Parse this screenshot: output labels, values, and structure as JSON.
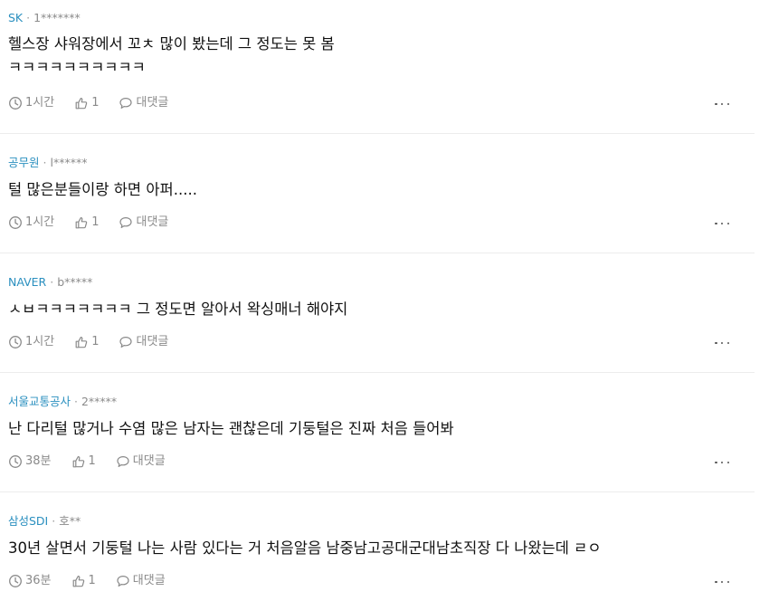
{
  "comments": [
    {
      "author": "SK",
      "separator": "·",
      "user_id": "1*******",
      "lines": [
        "헬스장 샤워장에서 꼬ㅊ 많이 봤는데 그 정도는 못 봄",
        "ㅋㅋㅋㅋㅋㅋㅋㅋㅋㅋ"
      ],
      "time": "1시간",
      "likes": "1",
      "reply_label": "대댓글"
    },
    {
      "author": "공무원",
      "separator": "·",
      "user_id": "l******",
      "lines": [
        "털 많은분들이랑 하면 아퍼....."
      ],
      "time": "1시간",
      "likes": "1",
      "reply_label": "대댓글"
    },
    {
      "author": "NAVER",
      "separator": "·",
      "user_id": "b*****",
      "lines": [
        "ㅅㅂㅋㅋㅋㅋㅋㅋㅋ 그 정도면 알아서 왁싱매너 해야지"
      ],
      "time": "1시간",
      "likes": "1",
      "reply_label": "대댓글"
    },
    {
      "author": "서울교통공사",
      "separator": "·",
      "user_id": "2*****",
      "lines": [
        "난 다리털 많거나 수염 많은 남자는 괜찮은데 기둥털은 진짜 처음 들어봐"
      ],
      "time": "38분",
      "likes": "1",
      "reply_label": "대댓글"
    },
    {
      "author": "삼성SDI",
      "separator": "·",
      "user_id": "호**",
      "lines": [
        "30년 살면서 기둥털 나는 사람 있다는 거 처음알음 남중남고공대군대남초직장 다 나왔는데 ㄹㅇ"
      ],
      "time": "36분",
      "likes": "1",
      "reply_label": "대댓글"
    }
  ]
}
